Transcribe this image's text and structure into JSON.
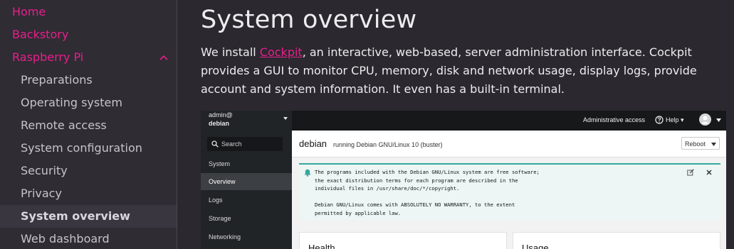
{
  "sidebar": {
    "top_items": [
      {
        "label": "Home"
      },
      {
        "label": "Backstory"
      },
      {
        "label": "Raspberry Pi"
      }
    ],
    "sub_items": [
      {
        "label": "Preparations"
      },
      {
        "label": "Operating system"
      },
      {
        "label": "Remote access"
      },
      {
        "label": "System configuration"
      },
      {
        "label": "Security"
      },
      {
        "label": "Privacy"
      },
      {
        "label": "System overview"
      },
      {
        "label": "Web dashboard"
      }
    ],
    "active_item": "System overview"
  },
  "main": {
    "title": "System overview",
    "paragraph_before_link": "We install ",
    "link_text": "Cockpit",
    "paragraph_after_link": ", an interactive, web-based, server administration interface. Cockpit provides a GUI to monitor CPU, memory, disk and network usage, display logs, provide account and system information. It even has a built-in terminal."
  },
  "cockpit": {
    "user": "admin@",
    "host": "debian",
    "search_label": "Search",
    "nav": [
      {
        "label": "System"
      },
      {
        "label": "Overview"
      },
      {
        "label": "Logs"
      },
      {
        "label": "Storage"
      },
      {
        "label": "Networking"
      }
    ],
    "active_nav": "Overview",
    "topbar": {
      "admin_access": "Administrative access",
      "help": "Help"
    },
    "header": {
      "host": "debian",
      "os": "running Debian GNU/Linux 10 (buster)",
      "reboot": "Reboot"
    },
    "motd": "The programs included with the Debian GNU/Linux system are free software;\nthe exact distribution terms for each program are described in the\nindividual files in /usr/share/doc/*/copyright.\n\nDebian GNU/Linux comes with ABSOLUTELY NO WARRANTY, to the extent\npermitted by applicable law.",
    "cards": [
      {
        "title": "Health"
      },
      {
        "title": "Usage"
      }
    ]
  },
  "colors": {
    "accent": "#e91e8c",
    "motd_border": "#35a89c"
  },
  "icons": {
    "chevron": "chevron-up-icon",
    "search": "search-icon",
    "bell": "bell-icon",
    "help": "help-icon",
    "avatar": "avatar-icon",
    "edit": "edit-icon",
    "close": "close-icon"
  }
}
